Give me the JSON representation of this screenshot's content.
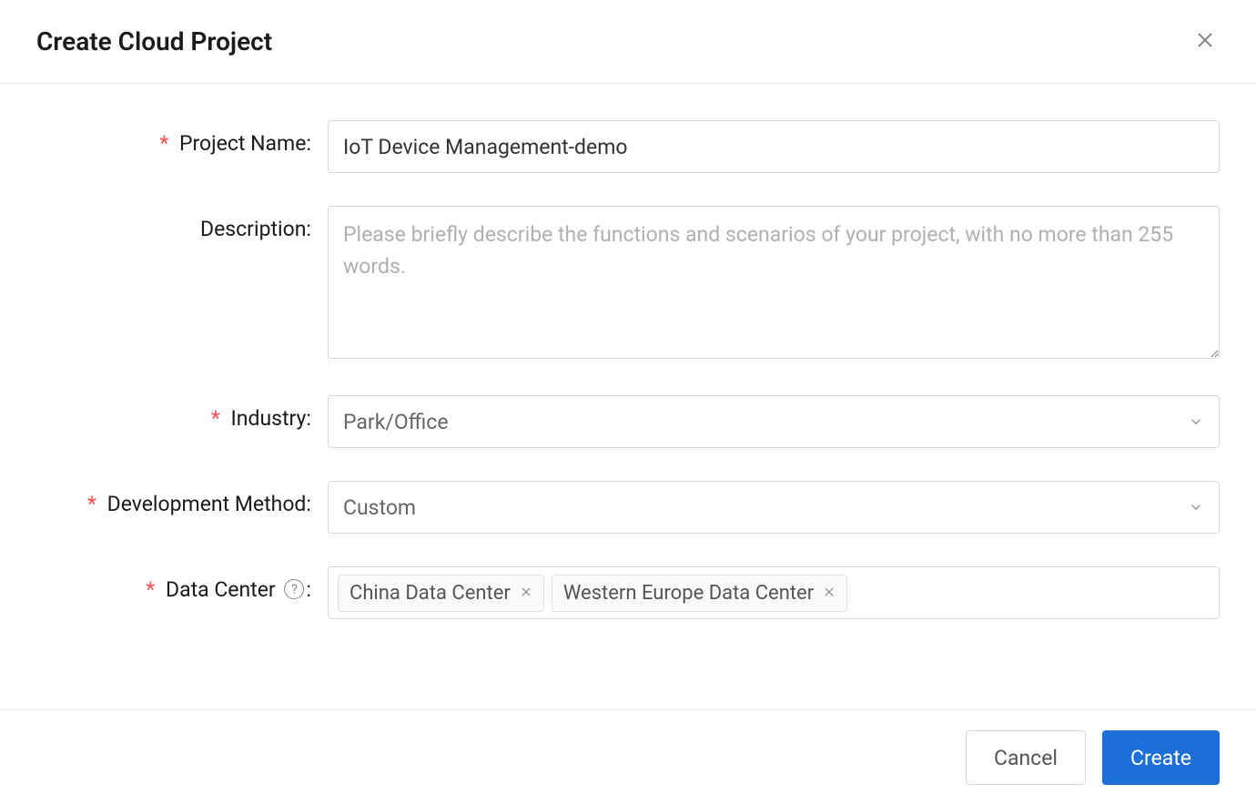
{
  "header": {
    "title": "Create Cloud Project"
  },
  "form": {
    "projectName": {
      "label": "Project Name",
      "value": "IoT Device Management-demo",
      "required": true
    },
    "description": {
      "label": "Description",
      "placeholder": "Please briefly describe the functions and scenarios of your project, with no more than 255 words.",
      "value": "",
      "required": false
    },
    "industry": {
      "label": "Industry",
      "selected": "Park/Office",
      "required": true
    },
    "developmentMethod": {
      "label": "Development Method",
      "selected": "Custom",
      "required": true
    },
    "dataCenter": {
      "label": "Data Center",
      "required": true,
      "tags": [
        "China Data Center",
        "Western Europe Data Center"
      ]
    }
  },
  "footer": {
    "cancelLabel": "Cancel",
    "createLabel": "Create"
  },
  "marks": {
    "required": "*",
    "colon": ":",
    "help": "?"
  }
}
